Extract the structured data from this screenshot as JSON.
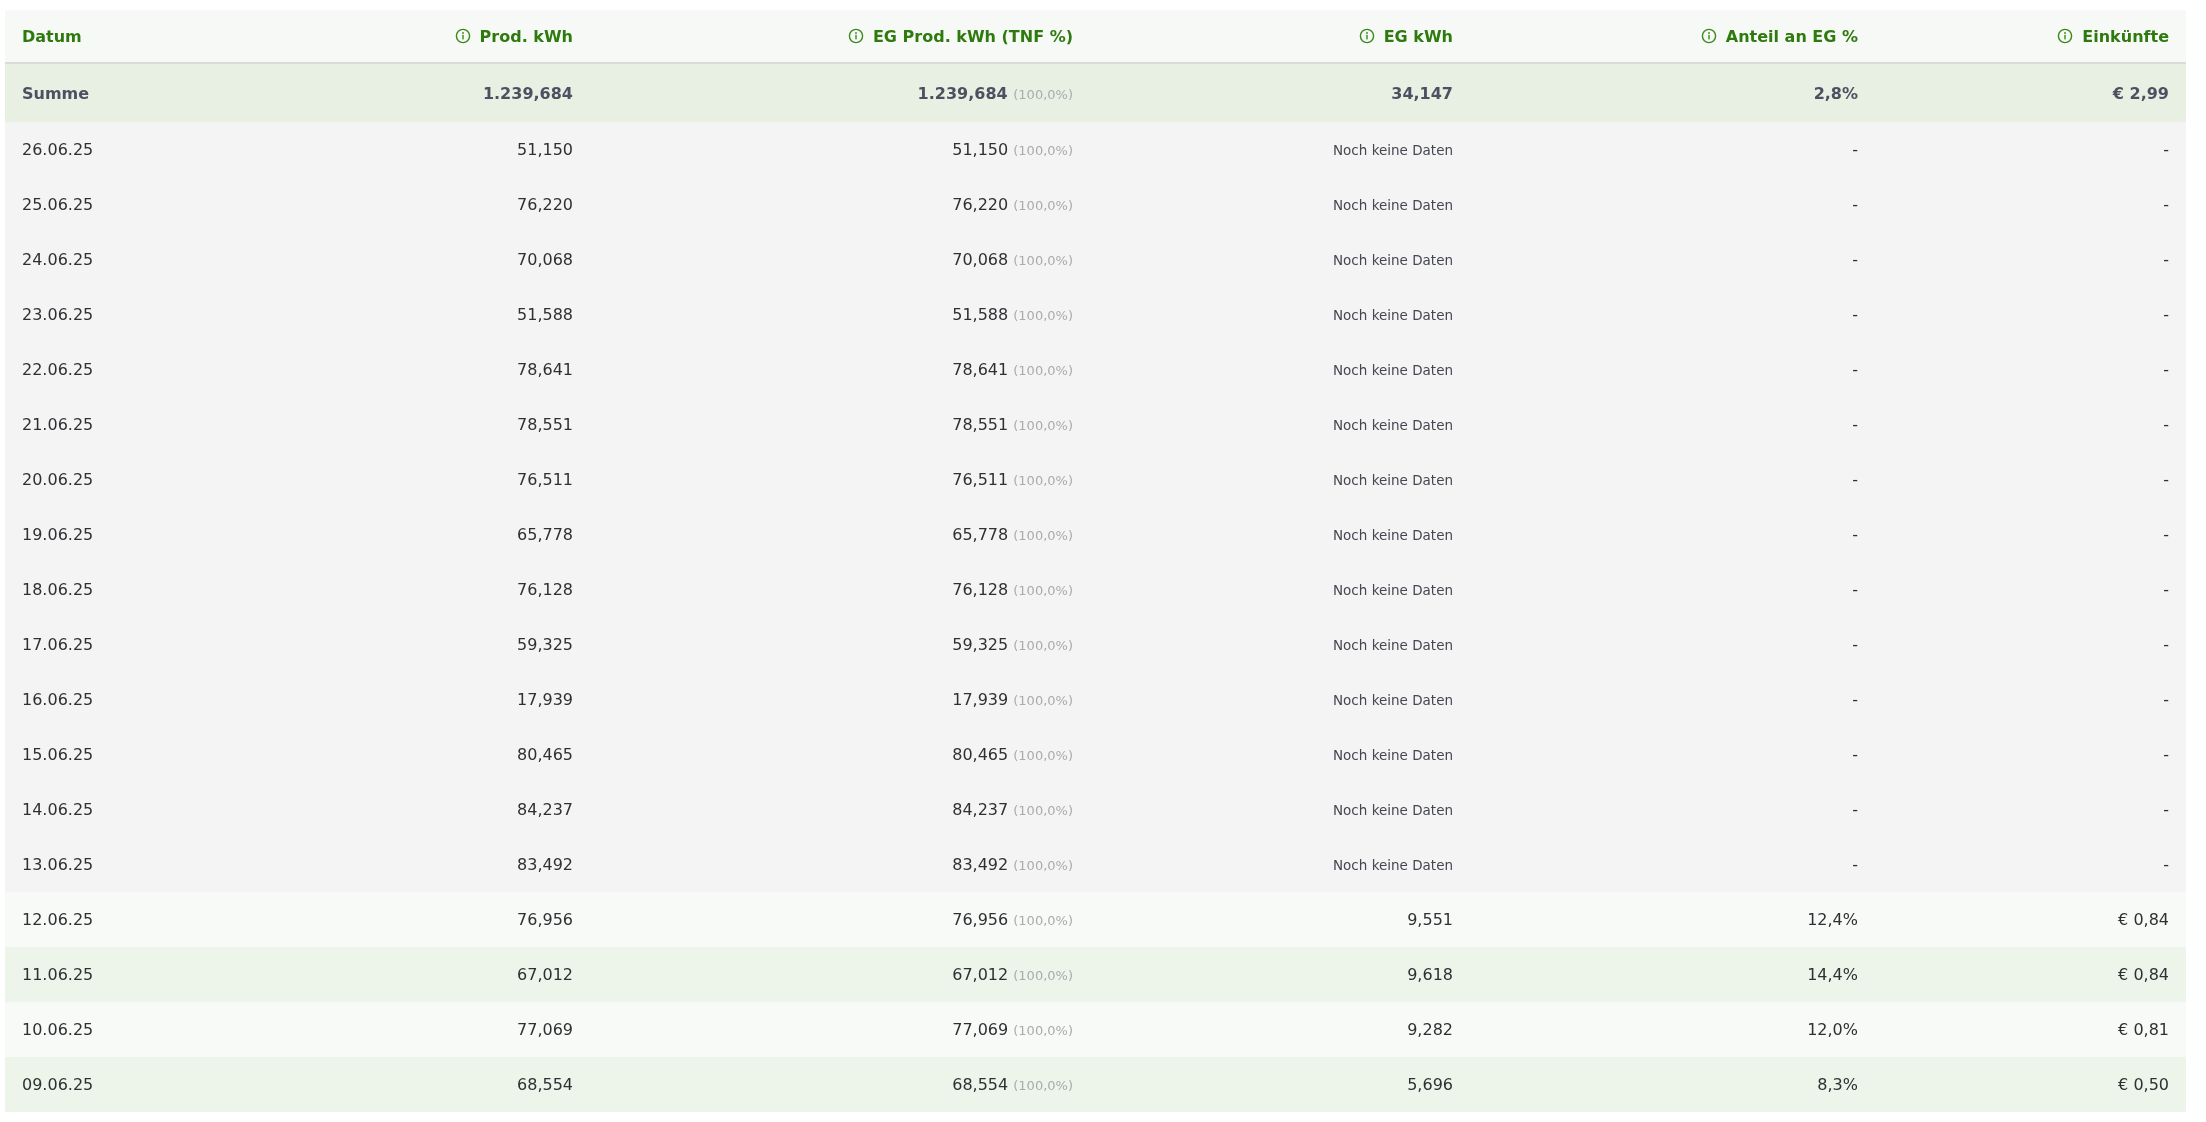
{
  "columns": [
    {
      "label": "Datum",
      "info": false
    },
    {
      "label": "Prod. kWh",
      "info": true
    },
    {
      "label": "EG Prod. kWh (TNF %)",
      "info": true
    },
    {
      "label": "EG kWh",
      "info": true
    },
    {
      "label": "Anteil an EG %",
      "info": true
    },
    {
      "label": "Einkünfte",
      "info": true
    }
  ],
  "summary": {
    "label": "Summe",
    "prod": "1.239,684",
    "eg_prod": "1.239,684",
    "eg_prod_pct": "(100,0%)",
    "eg_kwh": "34,147",
    "anteil": "2,8%",
    "einkuenfte": "€ 2,99"
  },
  "rows": [
    {
      "kind": "pending",
      "date": "26.06.25",
      "prod": "51,150",
      "eg_prod": "51,150",
      "eg_prod_pct": "(100,0%)",
      "eg_kwh": "Noch keine Daten",
      "anteil": "-",
      "einkuenfte": "-"
    },
    {
      "kind": "pending",
      "date": "25.06.25",
      "prod": "76,220",
      "eg_prod": "76,220",
      "eg_prod_pct": "(100,0%)",
      "eg_kwh": "Noch keine Daten",
      "anteil": "-",
      "einkuenfte": "-"
    },
    {
      "kind": "pending",
      "date": "24.06.25",
      "prod": "70,068",
      "eg_prod": "70,068",
      "eg_prod_pct": "(100,0%)",
      "eg_kwh": "Noch keine Daten",
      "anteil": "-",
      "einkuenfte": "-"
    },
    {
      "kind": "pending",
      "date": "23.06.25",
      "prod": "51,588",
      "eg_prod": "51,588",
      "eg_prod_pct": "(100,0%)",
      "eg_kwh": "Noch keine Daten",
      "anteil": "-",
      "einkuenfte": "-"
    },
    {
      "kind": "pending",
      "date": "22.06.25",
      "prod": "78,641",
      "eg_prod": "78,641",
      "eg_prod_pct": "(100,0%)",
      "eg_kwh": "Noch keine Daten",
      "anteil": "-",
      "einkuenfte": "-"
    },
    {
      "kind": "pending",
      "date": "21.06.25",
      "prod": "78,551",
      "eg_prod": "78,551",
      "eg_prod_pct": "(100,0%)",
      "eg_kwh": "Noch keine Daten",
      "anteil": "-",
      "einkuenfte": "-"
    },
    {
      "kind": "pending",
      "date": "20.06.25",
      "prod": "76,511",
      "eg_prod": "76,511",
      "eg_prod_pct": "(100,0%)",
      "eg_kwh": "Noch keine Daten",
      "anteil": "-",
      "einkuenfte": "-"
    },
    {
      "kind": "pending",
      "date": "19.06.25",
      "prod": "65,778",
      "eg_prod": "65,778",
      "eg_prod_pct": "(100,0%)",
      "eg_kwh": "Noch keine Daten",
      "anteil": "-",
      "einkuenfte": "-"
    },
    {
      "kind": "pending",
      "date": "18.06.25",
      "prod": "76,128",
      "eg_prod": "76,128",
      "eg_prod_pct": "(100,0%)",
      "eg_kwh": "Noch keine Daten",
      "anteil": "-",
      "einkuenfte": "-"
    },
    {
      "kind": "pending",
      "date": "17.06.25",
      "prod": "59,325",
      "eg_prod": "59,325",
      "eg_prod_pct": "(100,0%)",
      "eg_kwh": "Noch keine Daten",
      "anteil": "-",
      "einkuenfte": "-"
    },
    {
      "kind": "pending",
      "date": "16.06.25",
      "prod": "17,939",
      "eg_prod": "17,939",
      "eg_prod_pct": "(100,0%)",
      "eg_kwh": "Noch keine Daten",
      "anteil": "-",
      "einkuenfte": "-"
    },
    {
      "kind": "pending",
      "date": "15.06.25",
      "prod": "80,465",
      "eg_prod": "80,465",
      "eg_prod_pct": "(100,0%)",
      "eg_kwh": "Noch keine Daten",
      "anteil": "-",
      "einkuenfte": "-"
    },
    {
      "kind": "pending",
      "date": "14.06.25",
      "prod": "84,237",
      "eg_prod": "84,237",
      "eg_prod_pct": "(100,0%)",
      "eg_kwh": "Noch keine Daten",
      "anteil": "-",
      "einkuenfte": "-"
    },
    {
      "kind": "pending",
      "date": "13.06.25",
      "prod": "83,492",
      "eg_prod": "83,492",
      "eg_prod_pct": "(100,0%)",
      "eg_kwh": "Noch keine Daten",
      "anteil": "-",
      "einkuenfte": "-"
    },
    {
      "kind": "complete",
      "date": "12.06.25",
      "prod": "76,956",
      "eg_prod": "76,956",
      "eg_prod_pct": "(100,0%)",
      "eg_kwh": "9,551",
      "anteil": "12,4%",
      "einkuenfte": "€ 0,84"
    },
    {
      "kind": "complete",
      "date": "11.06.25",
      "prod": "67,012",
      "eg_prod": "67,012",
      "eg_prod_pct": "(100,0%)",
      "eg_kwh": "9,618",
      "anteil": "14,4%",
      "einkuenfte": "€ 0,84"
    },
    {
      "kind": "complete",
      "date": "10.06.25",
      "prod": "77,069",
      "eg_prod": "77,069",
      "eg_prod_pct": "(100,0%)",
      "eg_kwh": "9,282",
      "anteil": "12,0%",
      "einkuenfte": "€ 0,81"
    },
    {
      "kind": "complete",
      "date": "09.06.25",
      "prod": "68,554",
      "eg_prod": "68,554",
      "eg_prod_pct": "(100,0%)",
      "eg_kwh": "5,696",
      "anteil": "8,3%",
      "einkuenfte": "€ 0,50"
    }
  ]
}
